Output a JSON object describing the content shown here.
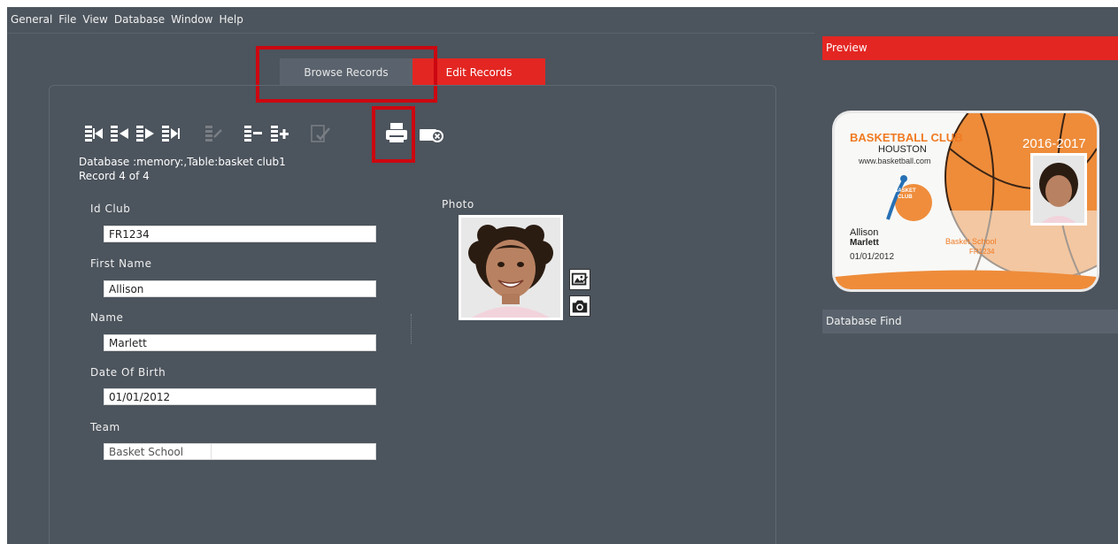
{
  "menu": [
    "General",
    "File",
    "View",
    "Database",
    "Window",
    "Help"
  ],
  "tabs": {
    "browse": "Browse Records",
    "edit": "Edit Records"
  },
  "status": {
    "database": "Database :memory:,Table:basket club1",
    "record": "Record 4 of 4"
  },
  "form": {
    "id_club": {
      "label": "Id Club",
      "value": "FR1234"
    },
    "first_name": {
      "label": "First Name",
      "value": "Allison"
    },
    "name": {
      "label": "Name",
      "value": "Marlett"
    },
    "dob": {
      "label": "Date Of Birth",
      "value": "01/01/2012"
    },
    "team": {
      "label": "Team",
      "value": "Basket School"
    },
    "photo_label": "Photo"
  },
  "dock": {
    "preview": "Preview",
    "find": "Database Find"
  },
  "card": {
    "title": "BASKETBALL CLUB",
    "city": "HOUSTON",
    "web": "www.basketball.com",
    "years": "2016-2017",
    "first_name": "Allison",
    "last_name": "Marlett",
    "dob": "01/01/2012",
    "team": "Basket School",
    "id": "FR1234",
    "logo_line1": "BASKET",
    "logo_line2": "CLUB"
  },
  "colors": {
    "background": "#4c545d",
    "accent": "#e32622",
    "highlight": "#cc0710",
    "card_orange": "#f07a21"
  },
  "icons": [
    "first-record-icon",
    "previous-record-icon",
    "next-record-icon",
    "last-record-icon",
    "undo-icon",
    "delete-record-icon",
    "add-record-icon",
    "validate-icon",
    "print-icon",
    "close-database-icon",
    "load-image-icon",
    "camera-icon"
  ]
}
